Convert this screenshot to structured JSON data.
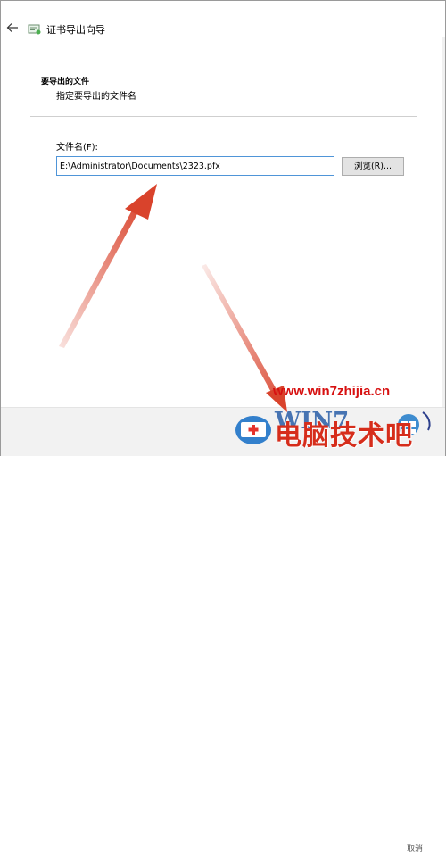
{
  "wizard": {
    "title": "证书导出向导"
  },
  "section": {
    "title": "要导出的文件",
    "description": "指定要导出的文件名"
  },
  "file_field": {
    "label": "文件名(F):",
    "value": "E:\\Administrator\\Documents\\2323.pfx"
  },
  "browse_button": {
    "label": "浏览(R)..."
  },
  "watermark": {
    "url": "www.win7zhijia.cn",
    "brand": "电脑技术吧"
  },
  "bottom_bar": {
    "hint": "取消"
  },
  "colors": {
    "input_focus_border": "#4f95d8",
    "annotation_arrow": "#d9432c",
    "watermark_red": "#d71010"
  }
}
